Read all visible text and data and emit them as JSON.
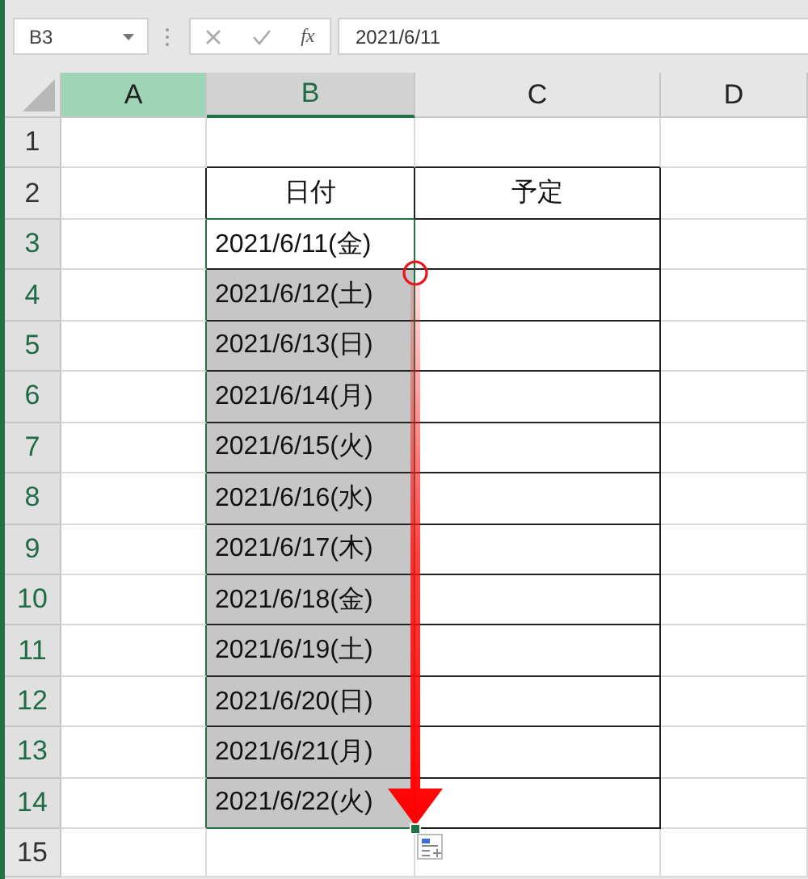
{
  "name_box": "B3",
  "function_label": "fx",
  "formula": "2021/6/11",
  "columns": [
    {
      "label": "A",
      "selected": false,
      "highlighted": true
    },
    {
      "label": "B",
      "selected": true,
      "highlighted": false
    },
    {
      "label": "C",
      "selected": false,
      "highlighted": false
    },
    {
      "label": "D",
      "selected": false,
      "highlighted": false
    }
  ],
  "rows": [
    {
      "header": "1",
      "selected": false,
      "in_table": false,
      "cells": {}
    },
    {
      "header": "2",
      "selected": false,
      "in_table": true,
      "cells": {
        "B": {
          "text": "日付",
          "selected": false
        },
        "C": {
          "text": "予定",
          "selected": false
        }
      }
    },
    {
      "header": "3",
      "selected": true,
      "in_table": true,
      "cells": {
        "B": {
          "text": "2021/6/11(金)",
          "selected": true,
          "active": true
        }
      }
    },
    {
      "header": "4",
      "selected": true,
      "in_table": true,
      "cells": {
        "B": {
          "text": "2021/6/12(土)",
          "selected": true,
          "active": false
        }
      }
    },
    {
      "header": "5",
      "selected": true,
      "in_table": true,
      "cells": {
        "B": {
          "text": "2021/6/13(日)",
          "selected": true,
          "active": false
        }
      }
    },
    {
      "header": "6",
      "selected": true,
      "in_table": true,
      "cells": {
        "B": {
          "text": "2021/6/14(月)",
          "selected": true,
          "active": false
        }
      }
    },
    {
      "header": "7",
      "selected": true,
      "in_table": true,
      "cells": {
        "B": {
          "text": "2021/6/15(火)",
          "selected": true,
          "active": false
        }
      }
    },
    {
      "header": "8",
      "selected": true,
      "in_table": true,
      "cells": {
        "B": {
          "text": "2021/6/16(水)",
          "selected": true,
          "active": false
        }
      }
    },
    {
      "header": "9",
      "selected": true,
      "in_table": true,
      "cells": {
        "B": {
          "text": "2021/6/17(木)",
          "selected": true,
          "active": false
        }
      }
    },
    {
      "header": "10",
      "selected": true,
      "in_table": true,
      "cells": {
        "B": {
          "text": "2021/6/18(金)",
          "selected": true,
          "active": false
        }
      }
    },
    {
      "header": "11",
      "selected": true,
      "in_table": true,
      "cells": {
        "B": {
          "text": "2021/6/19(土)",
          "selected": true,
          "active": false
        }
      }
    },
    {
      "header": "12",
      "selected": true,
      "in_table": true,
      "cells": {
        "B": {
          "text": "2021/6/20(日)",
          "selected": true,
          "active": false
        }
      }
    },
    {
      "header": "13",
      "selected": true,
      "in_table": true,
      "cells": {
        "B": {
          "text": "2021/6/21(月)",
          "selected": true,
          "active": false
        }
      }
    },
    {
      "header": "14",
      "selected": true,
      "in_table": true,
      "cells": {
        "B": {
          "text": "2021/6/22(火)",
          "selected": true,
          "active": false
        }
      }
    },
    {
      "header": "15",
      "selected": false,
      "in_table": false,
      "cells": {}
    }
  ]
}
